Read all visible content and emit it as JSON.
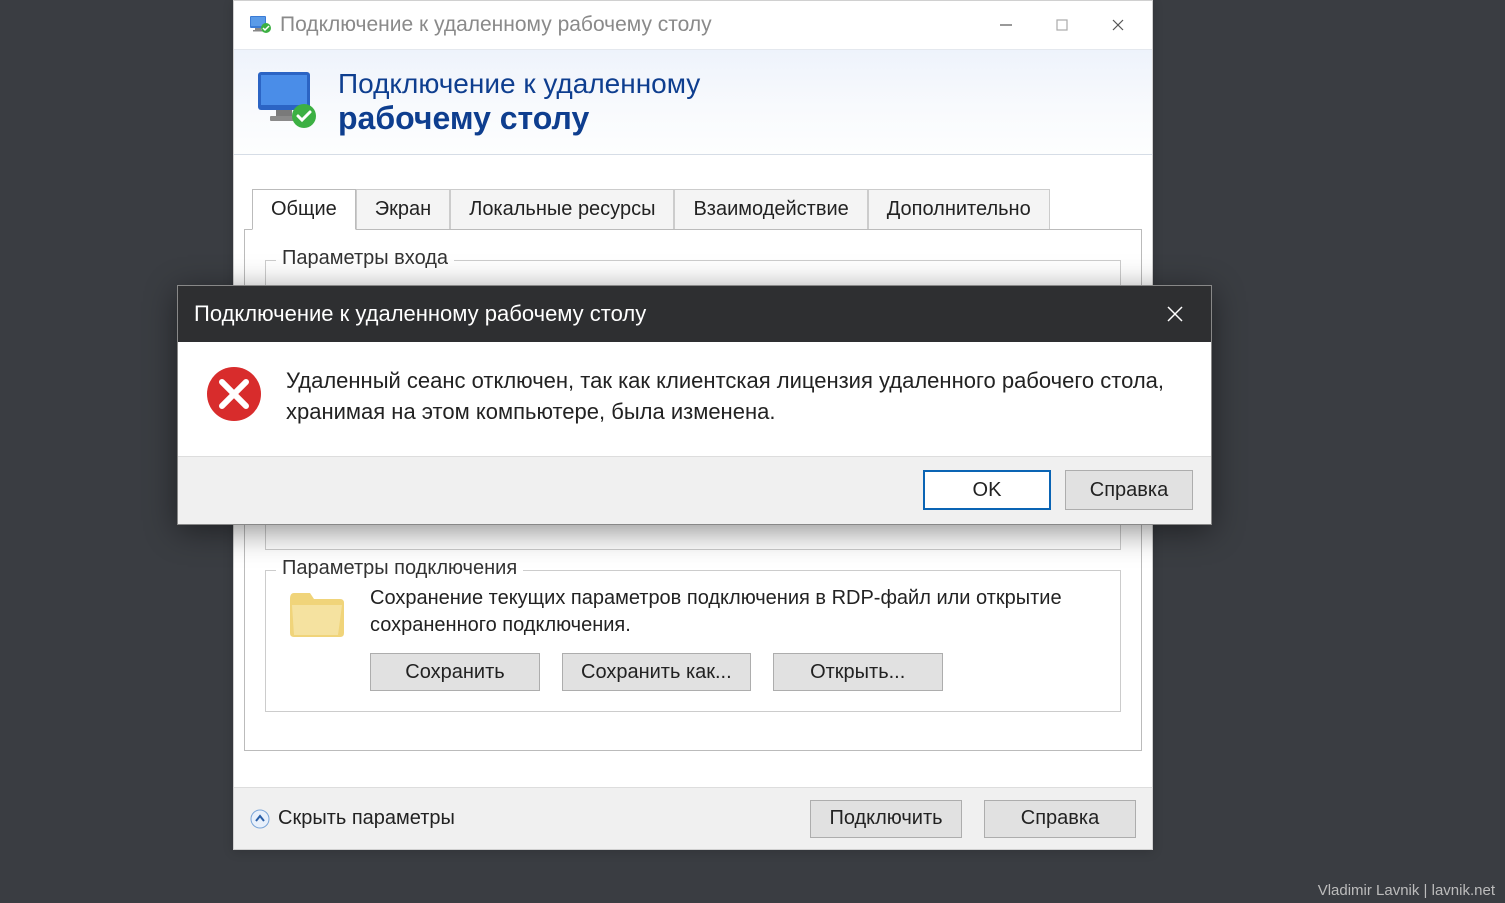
{
  "main_window": {
    "title": "Подключение к удаленному рабочему столу",
    "banner": {
      "line1": "Подключение к удаленному",
      "line2": "рабочему столу"
    },
    "tabs": {
      "general": "Общие",
      "screen": "Экран",
      "local_resources": "Локальные ресурсы",
      "experience": "Взаимодействие",
      "advanced": "Дополнительно"
    },
    "login_fieldset": {
      "legend": "Параметры входа"
    },
    "connection_fieldset": {
      "legend": "Параметры подключения",
      "description": "Сохранение текущих параметров подключения в RDP-файл или открытие сохраненного подключения.",
      "save_btn": "Сохранить",
      "save_as_btn": "Сохранить как...",
      "open_btn": "Открыть..."
    },
    "footer": {
      "collapse_label": "Скрыть параметры",
      "connect_btn": "Подключить",
      "help_btn": "Справка"
    }
  },
  "error_dialog": {
    "title": "Подключение к удаленному рабочему столу",
    "message": "Удаленный сеанс отключен, так как клиентская лицензия удаленного рабочего стола, хранимая на этом компьютере, была изменена.",
    "ok_btn": "OK",
    "help_btn": "Справка"
  },
  "watermark": "Vladimir Lavnik | lavnik.net"
}
